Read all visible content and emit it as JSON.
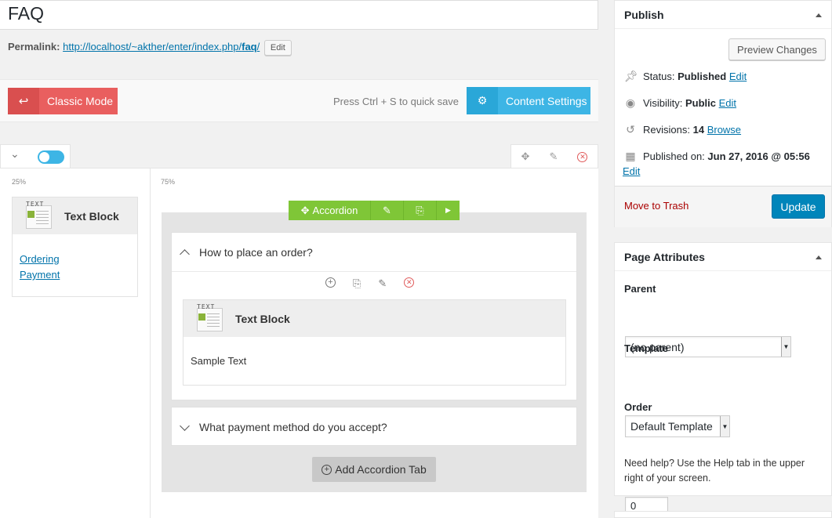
{
  "title": "FAQ",
  "permalink": {
    "label": "Permalink:",
    "url_prefix": "http://localhost/~akther/enter/index.php/",
    "slug": "faq",
    "url_suffix": "/",
    "edit_label": "Edit"
  },
  "modebar": {
    "classic_label": "Classic Mode",
    "quicksave_text": "Press Ctrl + S to quick save",
    "content_settings_label": "Content Settings"
  },
  "columns": {
    "left_pct": "25%",
    "right_pct": "75%"
  },
  "left_textblock": {
    "icon_word": "TEXT",
    "title": "Text Block",
    "links": [
      "Ordering",
      "Payment"
    ]
  },
  "accordion": {
    "toolbar_label": "Accordion",
    "tabs": [
      {
        "title": "How to place an order?",
        "expanded": true,
        "textblock": {
          "icon_word": "TEXT",
          "title": "Text Block",
          "body": "Sample Text"
        }
      },
      {
        "title": "What payment method do you accept?",
        "expanded": false
      }
    ],
    "add_tab_label": "Add Accordion Tab"
  },
  "publish": {
    "title": "Publish",
    "preview_label": "Preview Changes",
    "status_label": "Status:",
    "status_value": "Published",
    "visibility_label": "Visibility:",
    "visibility_value": "Public",
    "revisions_label": "Revisions:",
    "revisions_value": "14",
    "browse_label": "Browse",
    "published_on_label": "Published on:",
    "published_on_value": "Jun 27, 2016 @ 05:56",
    "edit_label": "Edit",
    "trash_label": "Move to Trash",
    "update_label": "Update"
  },
  "page_attributes": {
    "title": "Page Attributes",
    "parent_label": "Parent",
    "parent_value": "(no parent)",
    "template_label": "Template",
    "template_value": "Default Template",
    "order_label": "Order",
    "order_value": "0",
    "help_text_1": "Need help? Use the Help tab in the upper",
    "help_text_2": "right of your screen."
  },
  "colors": {
    "classic": "#e95f5f",
    "content_settings": "#3db5e5",
    "accordion": "#7fc637",
    "update": "#0085ba",
    "trash": "#a00"
  }
}
